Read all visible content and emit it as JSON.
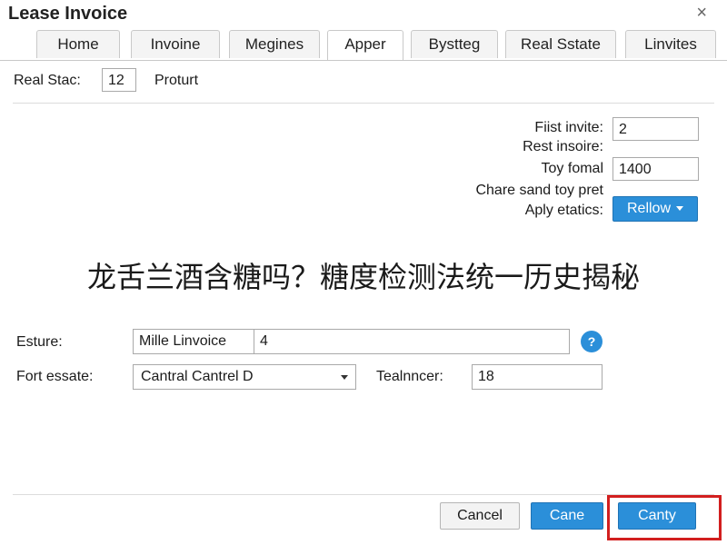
{
  "window": {
    "title": "Lease Invoice",
    "close_glyph": "×"
  },
  "tabs": [
    {
      "label": "Home"
    },
    {
      "label": "Invoine"
    },
    {
      "label": "Megines"
    },
    {
      "label": "Apper"
    },
    {
      "label": "Bystteg"
    },
    {
      "label": "Real Sstate"
    },
    {
      "label": "Linvites"
    }
  ],
  "top_row": {
    "real_stac_label": "Real Stac:",
    "real_stac_value": "12",
    "product_label": "Proturt"
  },
  "details": {
    "first_invite_label": "Fiist invite:",
    "first_invite_value": "2",
    "rest_income_label": "Rest insoire:",
    "toy_formal_label": "Toy fomal",
    "toy_formal_value": "1400",
    "chare_label": "Chare sand toy pret",
    "apply_label": "Aply etatics:",
    "reflow_button": "Rellow"
  },
  "overlay_caption": "龙舌兰酒含糖吗？糖度检测法统一历史揭秘",
  "form": {
    "esture_label": "Esture:",
    "esture_prefix": "Mille Linvoice",
    "esture_value": "4",
    "help_glyph": "?",
    "fort_estate_label": "Fort essate:",
    "fort_estate_selected": "Cantral Cantrel D",
    "teamncer_label": "Tealnncer:",
    "teamncer_value": "18"
  },
  "footer": {
    "cancel_label": "Cancel",
    "cane_label": "Cane",
    "canty_label": "Canty"
  },
  "colors": {
    "accent": "#2b8fd9",
    "highlight": "#d21f1f"
  }
}
